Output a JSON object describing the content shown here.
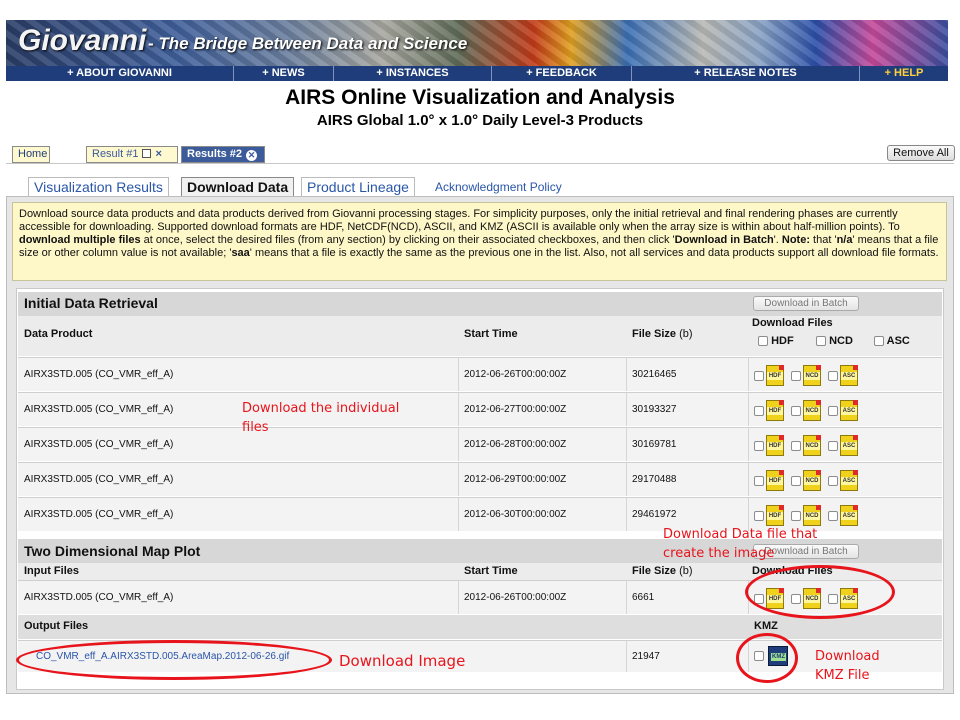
{
  "banner": {
    "logo": "Giovanni",
    "tagline": "- The Bridge Between Data and Science"
  },
  "nav": [
    "+ ABOUT GIOVANNI",
    "+ NEWS",
    "+ INSTANCES",
    "+ FEEDBACK",
    "+ RELEASE NOTES",
    "+ HELP"
  ],
  "page_title": "AIRS Online Visualization and Analysis",
  "page_subtitle": "AIRS Global 1.0° x 1.0° Daily Level-3 Products",
  "result_tabs": {
    "home": "Home",
    "result1": "Result #1",
    "result2": "Results #2",
    "remove_all": "Remove All"
  },
  "sub_tabs": {
    "viz": "Visualization Results",
    "download": "Download Data",
    "lineage": "Product Lineage",
    "ack": "Acknowledgment Policy"
  },
  "notice": {
    "p1": "Download source data products and data products derived from Giovanni processing stages. For simplicity purposes, only the initial retrieval and final rendering phases are currently accessible for downloading. Supported download formats are HDF, NetCDF(NCD), ASCII, and KMZ (ASCII is available only when the array size is within about half-million points). To ",
    "bold1": "download multiple files",
    "p2": " at once, select the desired files (from any section) by clicking on their associated checkboxes, and then click '",
    "bold2": "Download in Batch",
    "p3": "'.   ",
    "bold3": "Note:",
    "p4": " that '",
    "bold4": "n/a",
    "p5": "' means that a file size or other column value is not available; '",
    "bold5": "saa",
    "p6": "' means that a file is exactly the same as the previous one in the list. Also, not all services and data products support all download file formats."
  },
  "initial": {
    "title": "Initial Data Retrieval",
    "batch": "Download in Batch",
    "headers": {
      "product": "Data Product",
      "start": "Start Time",
      "size": "File Size",
      "size_unit": "(b)",
      "dl": "Download Files",
      "hdf": "HDF",
      "ncd": "NCD",
      "asc": "ASC"
    },
    "rows": [
      {
        "product": "AIRX3STD.005 (CO_VMR_eff_A)",
        "start": "2012-06-26T00:00:00Z",
        "size": "30216465"
      },
      {
        "product": "AIRX3STD.005 (CO_VMR_eff_A)",
        "start": "2012-06-27T00:00:00Z",
        "size": "30193327"
      },
      {
        "product": "AIRX3STD.005 (CO_VMR_eff_A)",
        "start": "2012-06-28T00:00:00Z",
        "size": "30169781"
      },
      {
        "product": "AIRX3STD.005 (CO_VMR_eff_A)",
        "start": "2012-06-29T00:00:00Z",
        "size": "29170488"
      },
      {
        "product": "AIRX3STD.005 (CO_VMR_eff_A)",
        "start": "2012-06-30T00:00:00Z",
        "size": "29461972"
      }
    ]
  },
  "map": {
    "title": "Two Dimensional Map Plot",
    "batch": "Download in Batch",
    "input_headers": {
      "files": "Input Files",
      "start": "Start Time",
      "size": "File Size",
      "size_unit": "(b)",
      "dl": "Download Files"
    },
    "input_row": {
      "file": "AIRX3STD.005 (CO_VMR_eff_A)",
      "start": "2012-06-26T00:00:00Z",
      "size": "6661"
    },
    "output_headers": {
      "files": "Output Files",
      "kmz": "KMZ"
    },
    "output_row": {
      "file": "CO_VMR_eff_A.AIRX3STD.005.AreaMap.2012-06-26.gif",
      "size": "21947"
    }
  },
  "icons": {
    "hdf": "HDF",
    "ncd": "NCD",
    "asc": "ASC",
    "kmz": "KMZ"
  },
  "annotations": {
    "individual": "Download the individual files",
    "datafile": "Download Data file that create the image",
    "image": "Download Image",
    "kmz": "Download KMZ File"
  },
  "colors": {
    "nav": "#1f3d7a",
    "help": "#ffd23a",
    "annotation": "#e8141c",
    "notice_bg": "#fef7c8",
    "file_icon": "#f0d21c"
  }
}
